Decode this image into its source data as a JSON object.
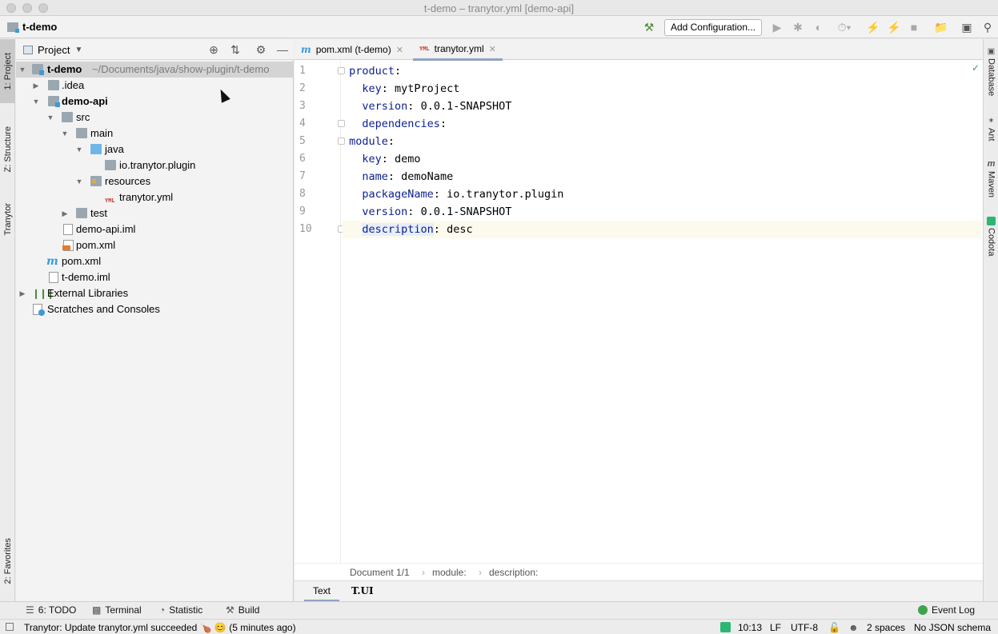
{
  "window": {
    "title": "t-demo – tranytor.yml [demo-api]"
  },
  "navbar": {
    "project": "t-demo",
    "add_configuration": "Add Configuration..."
  },
  "left_stripe": {
    "project": "1: Project",
    "structure": "Z: Structure",
    "tranytor": "Tranytor",
    "favorites": "2: Favorites"
  },
  "right_stripe": {
    "database": "Database",
    "ant": "Ant",
    "maven": "Maven",
    "codota": "Codota"
  },
  "project_panel": {
    "title": "Project",
    "tree": [
      {
        "label": "t-demo",
        "extra": "~/Documents/java/show-plugin/t-demo"
      },
      {
        "label": ".idea"
      },
      {
        "label": "demo-api"
      },
      {
        "label": "src"
      },
      {
        "label": "main"
      },
      {
        "label": "java"
      },
      {
        "label": "io.tranytor.plugin"
      },
      {
        "label": "resources"
      },
      {
        "label": "tranytor.yml"
      },
      {
        "label": "test"
      },
      {
        "label": "demo-api.iml"
      },
      {
        "label": "pom.xml"
      },
      {
        "label": "pom.xml"
      },
      {
        "label": "t-demo.iml"
      },
      {
        "label": "External Libraries"
      },
      {
        "label": "Scratches and Consoles"
      }
    ]
  },
  "editor": {
    "tabs": [
      {
        "label": "pom.xml (t-demo)"
      },
      {
        "label": "tranytor.yml"
      }
    ],
    "lines": [
      {
        "n": "1",
        "key": "product",
        "sep": ":",
        "value": ""
      },
      {
        "n": "2",
        "key": "key",
        "sep": ": ",
        "value": "mytProject"
      },
      {
        "n": "3",
        "key": "version",
        "sep": ": ",
        "value": "0.0.1-SNAPSHOT"
      },
      {
        "n": "4",
        "key": "dependencies",
        "sep": ":",
        "value": ""
      },
      {
        "n": "5",
        "key": "module",
        "sep": ":",
        "value": ""
      },
      {
        "n": "6",
        "key": "key",
        "sep": ": ",
        "value": "demo"
      },
      {
        "n": "7",
        "key": "name",
        "sep": ": ",
        "value": "demoName"
      },
      {
        "n": "8",
        "key": "packageName",
        "sep": ": ",
        "value": "io.tranytor.plugin"
      },
      {
        "n": "9",
        "key": "version",
        "sep": ": ",
        "value": "0.0.1-SNAPSHOT"
      },
      {
        "n": "10",
        "key": "description",
        "sep": ": ",
        "value": "desc"
      }
    ],
    "breadcrumbs": [
      "Document 1/1",
      "module:",
      "description:"
    ],
    "bottom_tabs": [
      "Text",
      "T.UI"
    ]
  },
  "bottom_toolbar": {
    "todo": "6: TODO",
    "terminal": "Terminal",
    "statistic": "Statistic",
    "build": "Build",
    "event_log": "Event Log"
  },
  "status": {
    "message": "Tranytor: Update tranytor.yml succeeded 🍗 😊 (5 minutes ago)",
    "position": "10:13",
    "line_sep": "LF",
    "encoding": "UTF-8",
    "indent": "2 spaces",
    "schema": "No JSON schema"
  }
}
